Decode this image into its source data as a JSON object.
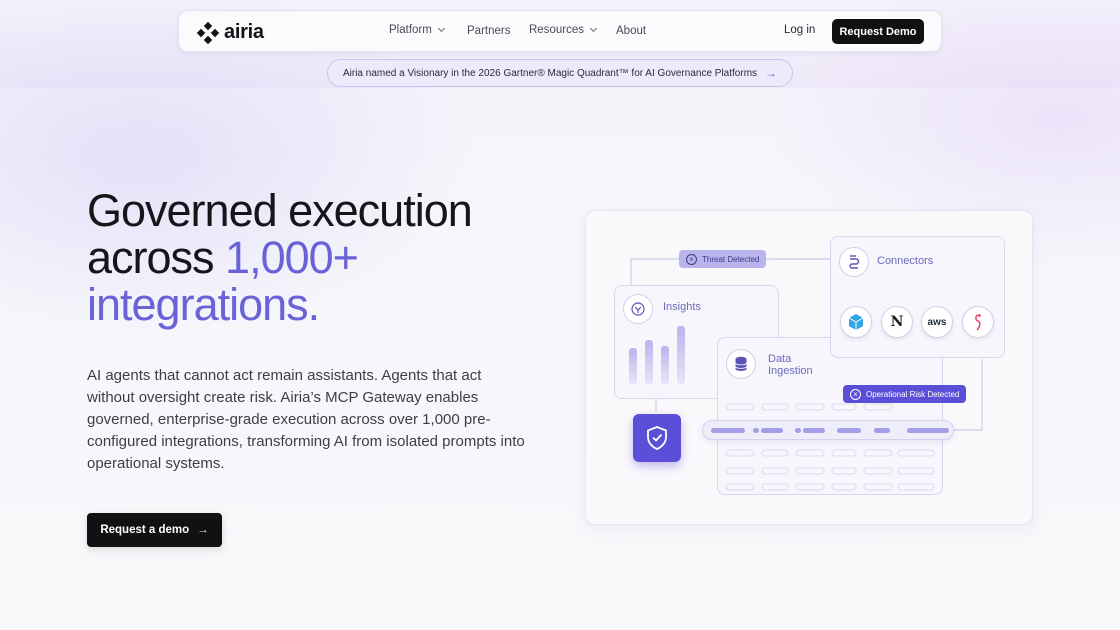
{
  "brand": {
    "name": "airia"
  },
  "nav": {
    "items": [
      {
        "label": "Platform",
        "has_dropdown": true
      },
      {
        "label": "Partners",
        "has_dropdown": false
      },
      {
        "label": "Resources",
        "has_dropdown": true
      },
      {
        "label": "About",
        "has_dropdown": false
      }
    ],
    "login_label": "Log in",
    "request_demo_label": "Request Demo"
  },
  "banner": {
    "text": "Airia named a Visionary in the 2026 Gartner® Magic Quadrant™ for AI Governance Platforms",
    "arrow": "→"
  },
  "hero": {
    "title_line1": "Governed execution",
    "title_line2_plain": "across ",
    "title_line2_accent": "1,000+",
    "title_line3_accent": "integrations.",
    "body": "AI agents that cannot act remain assistants. Agents that act without oversight create risk. Airia’s MCP Gateway enables governed, enterprise-grade execution across over 1,000 pre-configured integrations, transforming AI from isolated prompts into operational systems.",
    "cta_label": "Request a demo",
    "cta_arrow": "→"
  },
  "illustration": {
    "threat_tag": "Threat Detected",
    "connectors_label": "Connectors",
    "insights_label": "Insights",
    "data_ingestion_label_line1": "Data",
    "data_ingestion_label_line2": "Ingestion",
    "risk_tag": "Operational Risk Detected",
    "connector_apps": [
      "cube-icon",
      "notion-icon",
      "aws-icon",
      "flamingo-icon"
    ],
    "aws_text": "aws",
    "notion_text": "N",
    "colors": {
      "accent": "#6a63d8",
      "tag": "#6b5fd6",
      "shield": "#5b4fd8"
    }
  }
}
